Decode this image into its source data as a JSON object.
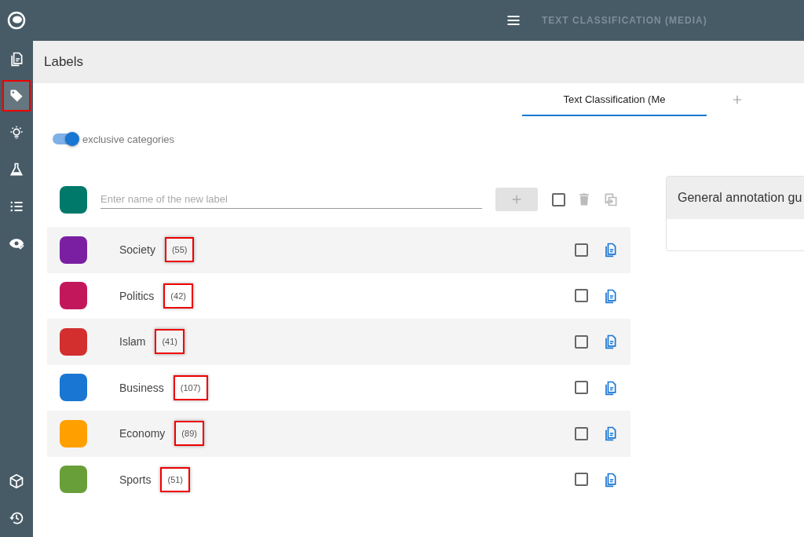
{
  "sidebar": {
    "items": [
      {
        "kind": "documents",
        "selected": false
      },
      {
        "kind": "tag",
        "selected": true
      },
      {
        "kind": "bulb",
        "selected": false
      },
      {
        "kind": "flask",
        "selected": false
      },
      {
        "kind": "list",
        "selected": false
      },
      {
        "kind": "eye-check",
        "selected": false
      }
    ],
    "bottom_items": [
      {
        "kind": "cube",
        "selected": false
      },
      {
        "kind": "history",
        "selected": false
      }
    ]
  },
  "topbar": {
    "project_title": "TEXT CLASSIFICATION (MEDIA)"
  },
  "page_title": "Labels",
  "tabs": [
    {
      "label": "Text Classification (Me",
      "selected": true
    }
  ],
  "exclusive_toggle": {
    "label": "exclusive categories",
    "on": true
  },
  "new_label": {
    "color": "#00796b",
    "placeholder": "Enter name of the new label",
    "select_all_checked": false
  },
  "labels": [
    {
      "name": "Society",
      "count": "(55)",
      "color": "#7b1fa2",
      "highlighted": true,
      "checked": false
    },
    {
      "name": "Politics",
      "count": "(42)",
      "color": "#c2185b",
      "highlighted": true,
      "checked": false
    },
    {
      "name": "Islam",
      "count": "(41)",
      "color": "#d32f2f",
      "highlighted": true,
      "checked": false
    },
    {
      "name": "Business",
      "count": "(107)",
      "color": "#1976d2",
      "highlighted": true,
      "checked": false
    },
    {
      "name": "Economy",
      "count": "(89)",
      "color": "#ffa000",
      "highlighted": true,
      "checked": false
    },
    {
      "name": "Sports",
      "count": "(51)",
      "color": "#689f38",
      "highlighted": true,
      "checked": false
    }
  ],
  "guidelines_card": {
    "title": "General annotation gu"
  }
}
